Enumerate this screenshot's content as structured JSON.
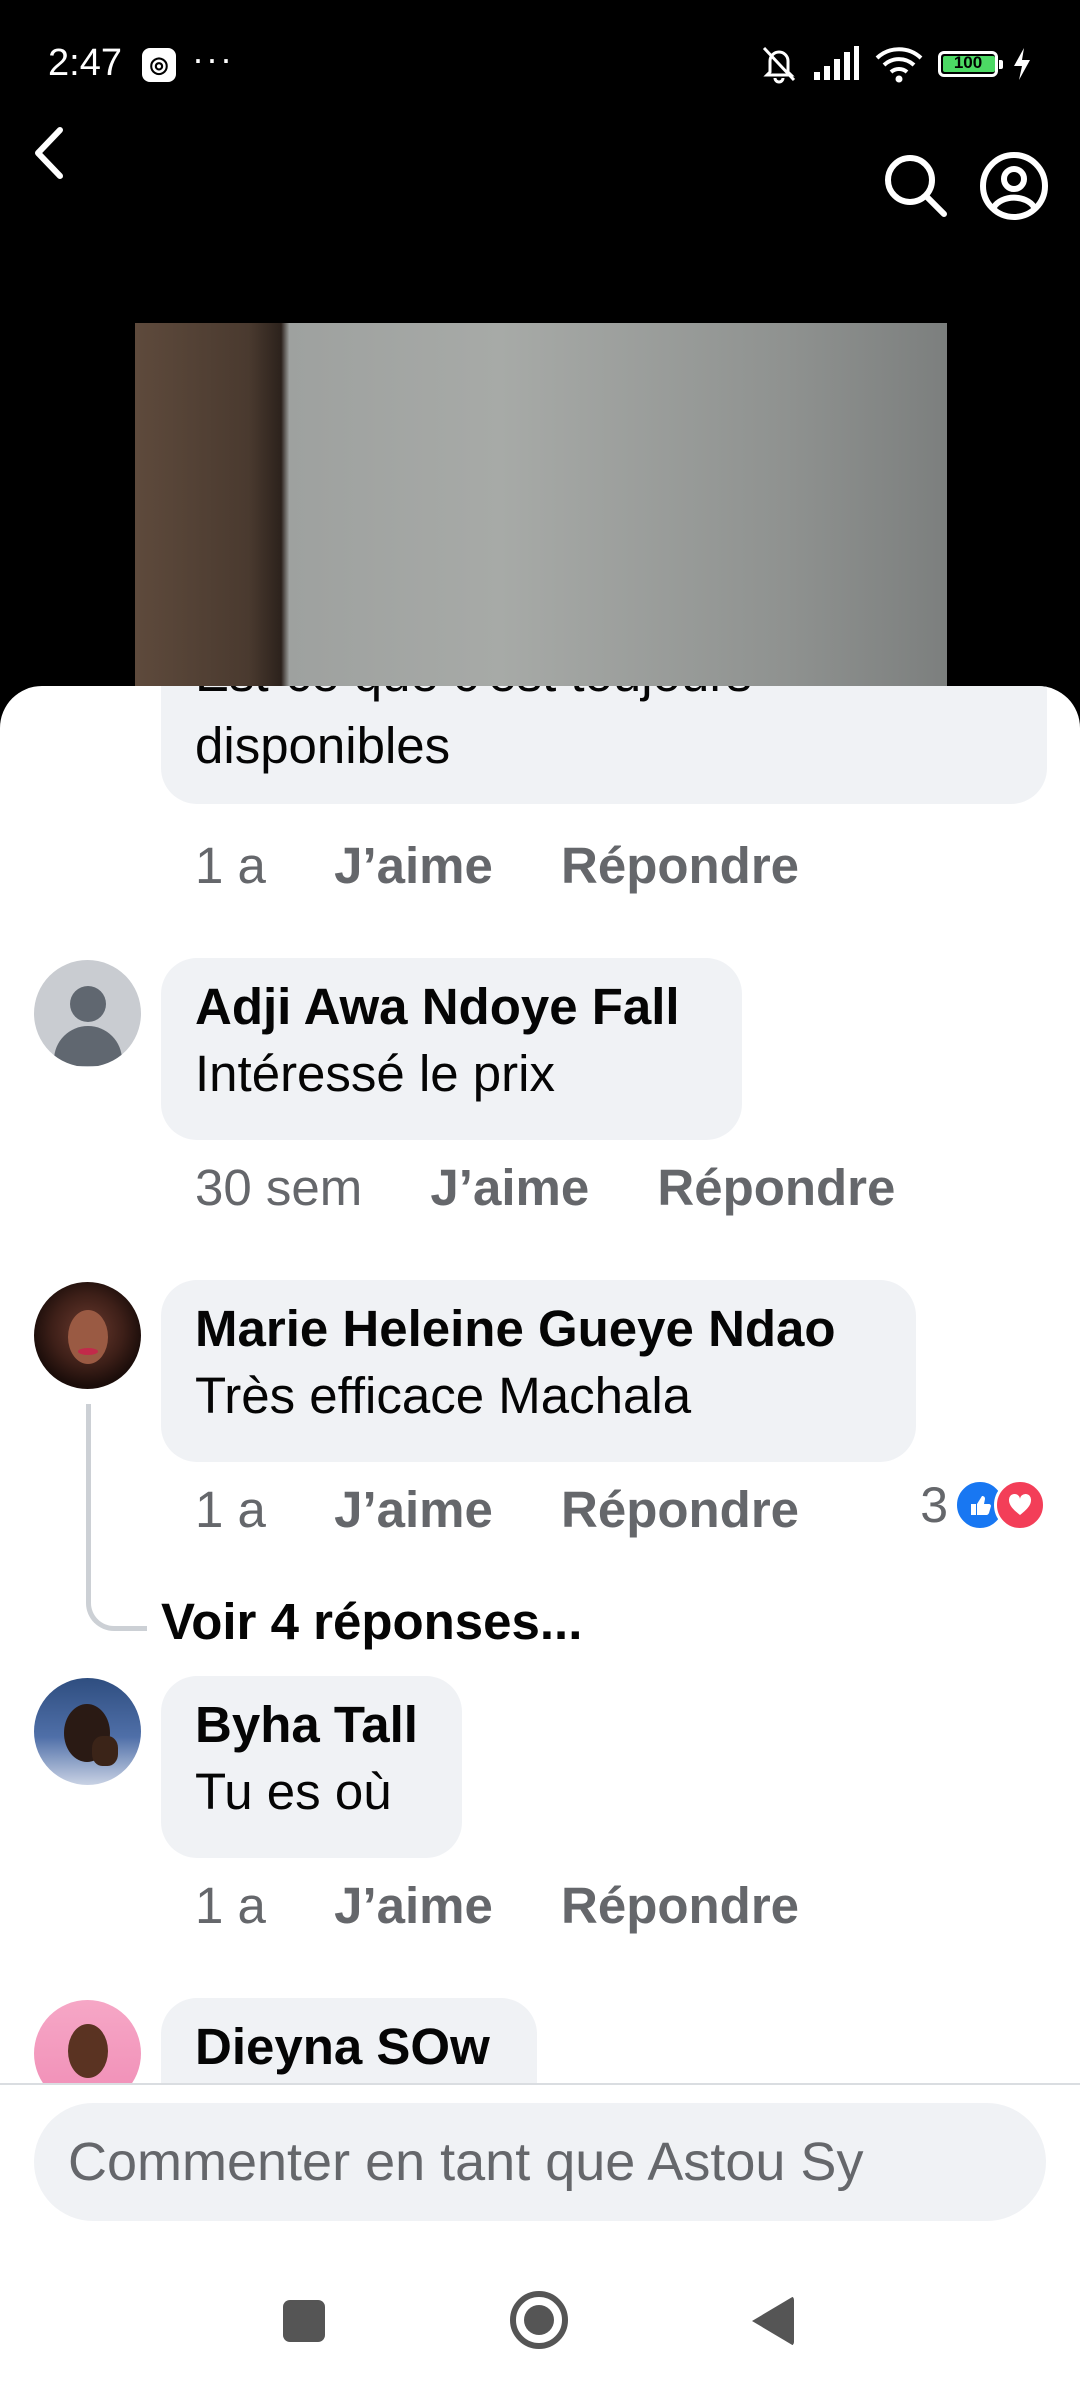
{
  "status_bar": {
    "time": "2:47",
    "dots": "···",
    "battery": "100"
  },
  "comments": [
    {
      "name": "",
      "text_partial": "Est-ce que c'est toujours",
      "text": "disponibles",
      "time": "1 a",
      "like": "J’aime",
      "reply": "Répondre"
    },
    {
      "name": "Adji Awa Ndoye Fall",
      "text": "Intéressé le prix",
      "time": "30 sem",
      "like": "J’aime",
      "reply": "Répondre"
    },
    {
      "name": "Marie Heleine Gueye Ndao",
      "text": "Très efficace Machala",
      "time": "1 a",
      "like": "J’aime",
      "reply": "Répondre",
      "reaction_count": "3",
      "more_replies": "Voir 4 réponses..."
    },
    {
      "name": "Byha Tall",
      "text": "Tu es où",
      "time": "1 a",
      "like": "J’aime",
      "reply": "Répondre"
    },
    {
      "name": "Dieyna SOw"
    }
  ],
  "composer": {
    "placeholder": "Commenter en tant que Astou Sy"
  },
  "colors": {
    "like_blue": "#1877f2",
    "love_red": "#f33e58",
    "bubble": "#f0f2f5",
    "meta_gray": "#65676b"
  }
}
